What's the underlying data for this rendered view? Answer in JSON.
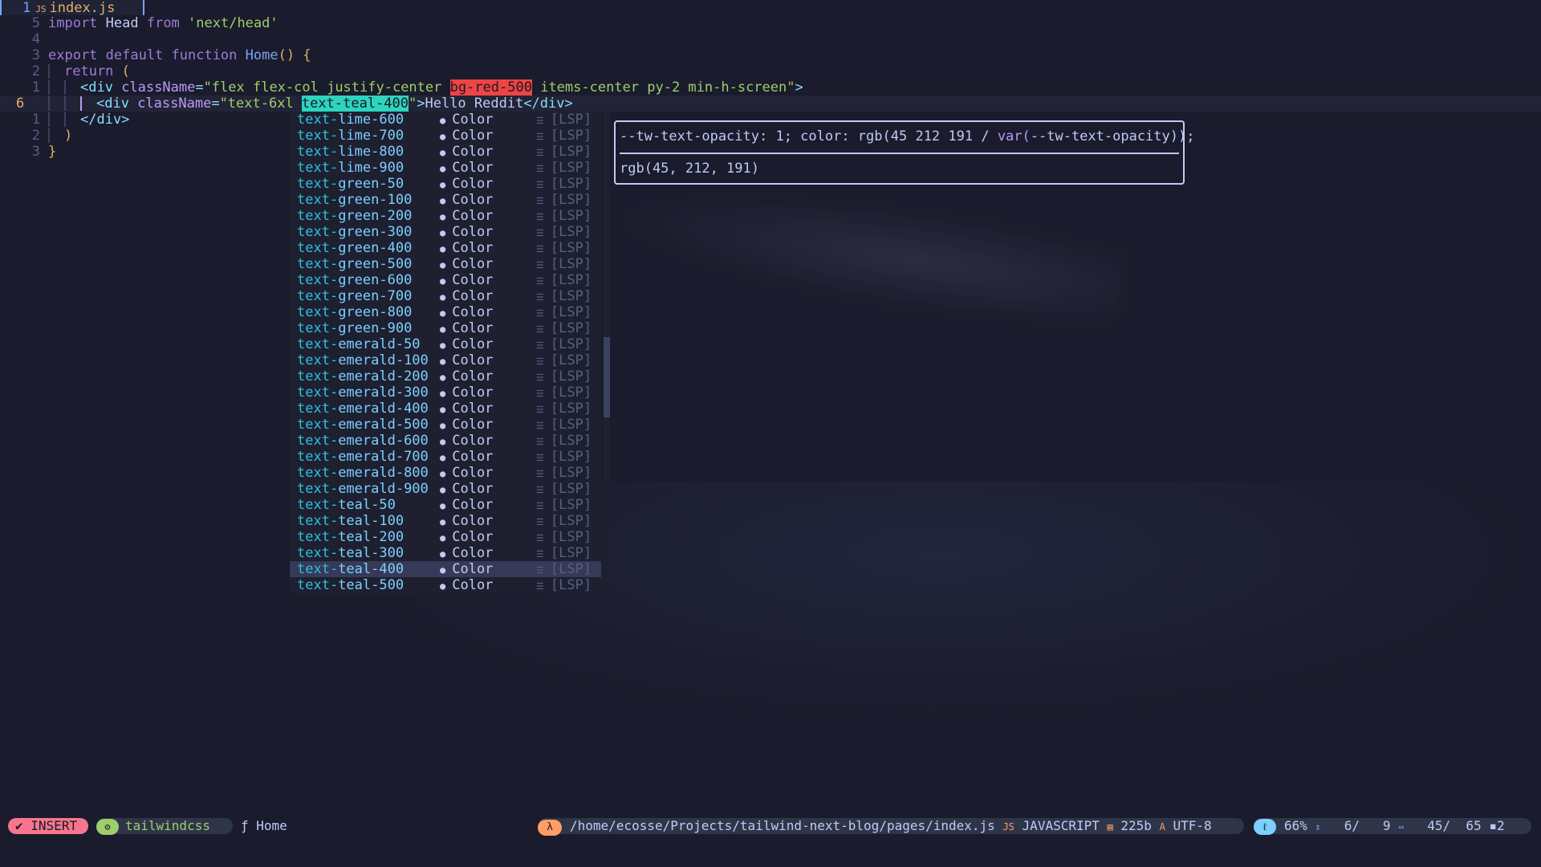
{
  "tab": {
    "number": "1",
    "icon": "JS",
    "filename": "index.js"
  },
  "lines": [
    {
      "num": "5",
      "parts": [
        [
          "kw",
          "import "
        ],
        [
          "plain",
          "Head "
        ],
        [
          "kw",
          "from "
        ],
        [
          "str",
          "'next/head'"
        ]
      ]
    },
    {
      "num": "4",
      "parts": []
    },
    {
      "num": "3",
      "parts": [
        [
          "kw",
          "export default function "
        ],
        [
          "fn",
          "Home"
        ],
        [
          "paren",
          "() {"
        ]
      ]
    },
    {
      "num": "2",
      "parts": [
        [
          "kw",
          "return "
        ],
        [
          "paren",
          "("
        ]
      ]
    },
    {
      "num": "1",
      "parts": [
        [
          "tag",
          "<div "
        ],
        [
          "attr",
          "className"
        ],
        [
          "tag",
          "="
        ],
        [
          "str",
          "\"flex flex-col justify-center "
        ],
        [
          "redhl",
          "bg-red-500"
        ],
        [
          "str",
          " items-center py-2 min-h-screen\""
        ],
        [
          "tag",
          ">"
        ]
      ]
    },
    {
      "num": "6",
      "parts": [
        [
          "tag",
          "<div "
        ],
        [
          "attr",
          "className"
        ],
        [
          "tag",
          "="
        ],
        [
          "str",
          "\"text-6xl "
        ],
        [
          "tealhl",
          "text-teal-400"
        ],
        [
          "str",
          "\""
        ],
        [
          "tag",
          ">"
        ],
        [
          "plain",
          "Hello Reddit"
        ],
        [
          "tag",
          "</div>"
        ]
      ]
    },
    {
      "num": "1",
      "parts": [
        [
          "tag",
          "</div>"
        ]
      ]
    },
    {
      "num": "2",
      "parts": [
        [
          "paren",
          ")"
        ]
      ]
    },
    {
      "num": "3",
      "parts": [
        [
          "paren",
          "}"
        ]
      ]
    }
  ],
  "completion": {
    "kind_label": "Color",
    "kind_icon": "palette-icon",
    "source_label": "[LSP]",
    "source_icon": "lsp-icon",
    "items": [
      "text-lime-600",
      "text-lime-700",
      "text-lime-800",
      "text-lime-900",
      "text-green-50",
      "text-green-100",
      "text-green-200",
      "text-green-300",
      "text-green-400",
      "text-green-500",
      "text-green-600",
      "text-green-700",
      "text-green-800",
      "text-green-900",
      "text-emerald-50",
      "text-emerald-100",
      "text-emerald-200",
      "text-emerald-300",
      "text-emerald-400",
      "text-emerald-500",
      "text-emerald-600",
      "text-emerald-700",
      "text-emerald-800",
      "text-emerald-900",
      "text-teal-50",
      "text-teal-100",
      "text-teal-200",
      "text-teal-300",
      "text-teal-400",
      "text-teal-500"
    ],
    "selected": "text-teal-400"
  },
  "doc": {
    "css_prefix": "--tw-text-opacity: 1; color: rgb(45 212 191 / ",
    "css_var": "var(",
    "css_suffix": "--tw-text-opacity));",
    "value": "rgb(45, 212, 191)"
  },
  "statusline": {
    "mode": "INSERT",
    "mode_icon": "✔",
    "lsp_icon": "⚙",
    "lsp_name": "tailwindcss",
    "func_icon": "ƒ",
    "func_name": "Home",
    "file_icon": "λ",
    "path": "/home/ecosse/Projects/tailwind-next-blog/pages/index.js",
    "js_icon": "JS",
    "filetype": "JAVASCRIPT",
    "size_icon": "▤",
    "size": "225b",
    "enc_icon": "A",
    "encoding": "UTF-8",
    "pos_icon": "ℓ",
    "percent": "66%",
    "row_icon": "⇕",
    "row": "6/   9",
    "col_icon": "⇔",
    "col": "45/  65",
    "extra": "▪2"
  },
  "colors": {
    "teal": "#2dd4bf",
    "red": "#ef4444",
    "mode_bg": "#f7768e"
  }
}
